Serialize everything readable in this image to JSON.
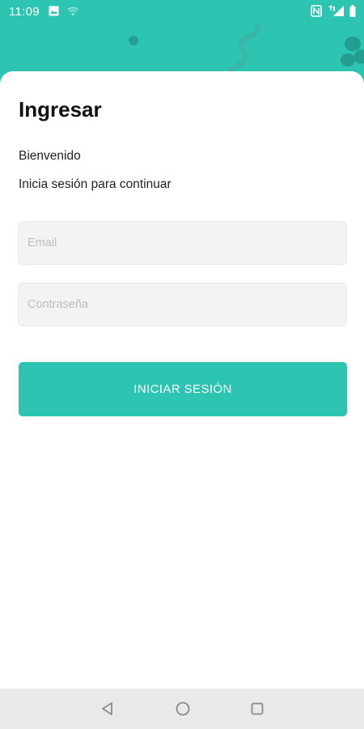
{
  "status_bar": {
    "time": "11:09",
    "icons": [
      "image-icon",
      "hotspot-icon",
      "nfc-icon",
      "signal-icon",
      "battery-icon"
    ]
  },
  "login": {
    "title": "Ingresar",
    "welcome": "Bienvenido",
    "subtitle": "Inicia sesión para continuar",
    "email_placeholder": "Email",
    "email_value": "",
    "password_placeholder": "Contraseña",
    "password_value": "",
    "submit_label": "INICIAR SESIÓN"
  },
  "nav_bar": {
    "buttons": [
      "back-icon",
      "home-icon",
      "recents-icon"
    ]
  },
  "colors": {
    "accent": "#2EC4B2",
    "card": "#FFFFFF",
    "field_background": "#F3F3F3",
    "nav_background": "#E9E9E9"
  }
}
